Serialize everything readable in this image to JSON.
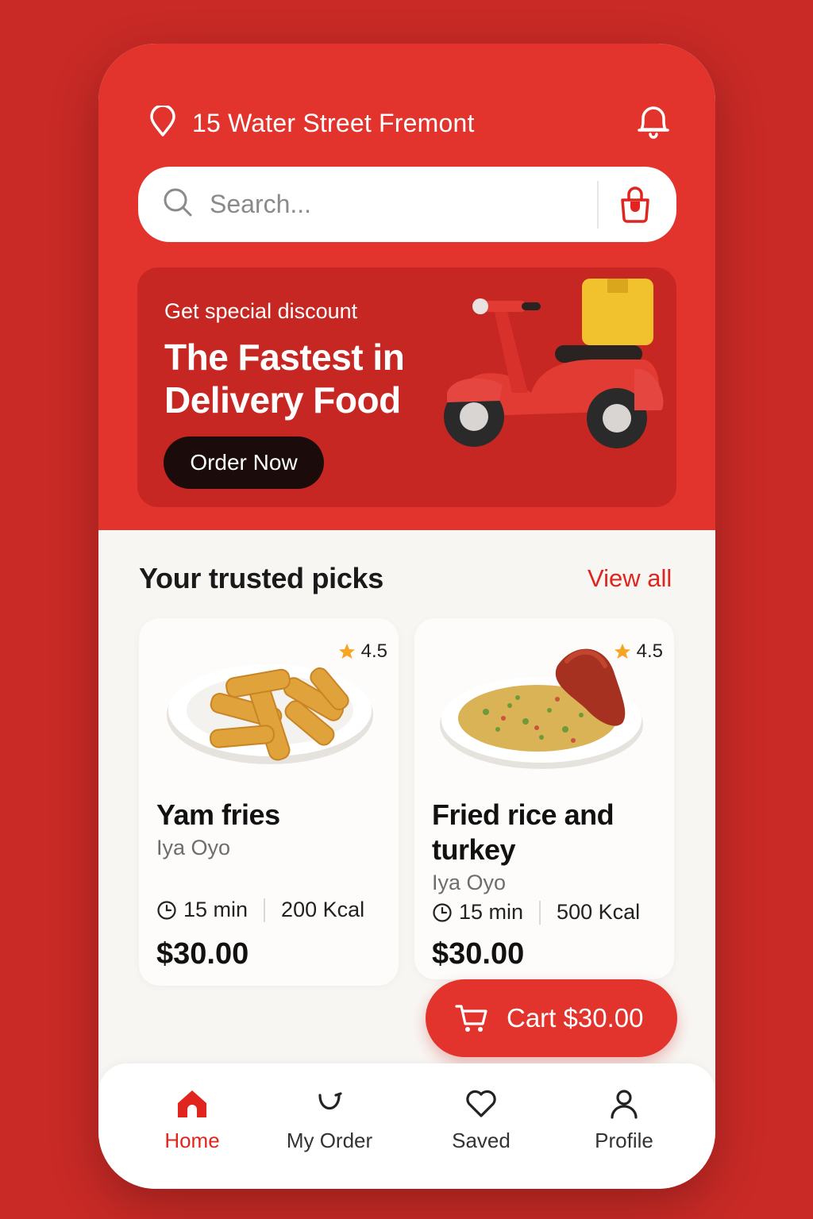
{
  "header": {
    "location": "15 Water Street Fremont",
    "location_icon": "map-pin-icon",
    "notification_icon": "bell-icon"
  },
  "search": {
    "placeholder": "Search...",
    "icon": "search-icon",
    "bag_icon": "shopping-bag-icon"
  },
  "banner": {
    "subtitle": "Get special discount",
    "title": "The Fastest in Delivery Food",
    "button_label": "Order Now",
    "image": "delivery-scooter"
  },
  "section": {
    "title": "Your trusted picks",
    "view_all": "View all"
  },
  "items": [
    {
      "name": "Yam fries",
      "vendor": "Iya Oyo",
      "rating": "4.5",
      "time": "15 min",
      "calories": "200 Kcal",
      "price": "$30.00"
    },
    {
      "name": "Fried rice and turkey",
      "vendor": "Iya Oyo",
      "rating": "4.5",
      "time": "15 min",
      "calories": "500 Kcal",
      "price": "$30.00"
    }
  ],
  "cart": {
    "label": "Cart $30.00",
    "icon": "cart-icon"
  },
  "nav": {
    "items": [
      {
        "label": "Home",
        "icon": "home-icon",
        "active": true
      },
      {
        "label": "My Order",
        "icon": "order-icon",
        "active": false
      },
      {
        "label": "Saved",
        "icon": "heart-icon",
        "active": false
      },
      {
        "label": "Profile",
        "icon": "user-icon",
        "active": false
      }
    ]
  },
  "colors": {
    "brand": "#e2332d",
    "banner": "#c72723",
    "background": "#c92a26",
    "accent_text": "#e0251f",
    "star": "#f5a623"
  }
}
